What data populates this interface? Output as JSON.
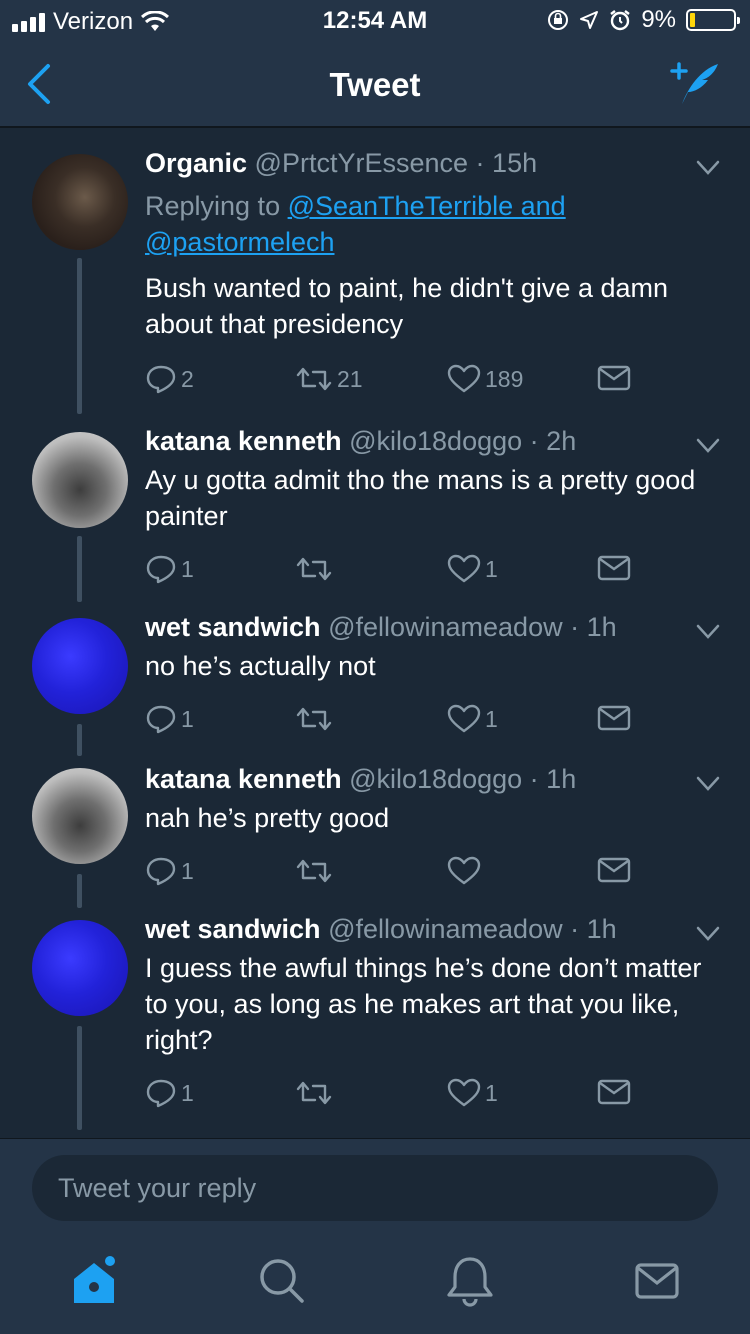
{
  "status_bar": {
    "carrier": "Verizon",
    "time": "12:54 AM",
    "battery": "9%",
    "battery_level": 0.09
  },
  "navbar": {
    "title": "Tweet",
    "back_icon": "chevron-left-icon",
    "compose_icon": "compose-tweet-icon"
  },
  "tweets": [
    {
      "name": "Organic",
      "handle": "@PrtctYrEssence",
      "time": "15h",
      "replying_prefix": "Replying to ",
      "replying_link_1": "@SeanTheTerrible and",
      "replying_link_2": "@pastormelech",
      "text": "Bush wanted to paint, he didn't give a damn about that presidency",
      "replies": "2",
      "retweets": "21",
      "likes": "189"
    },
    {
      "name": "katana kenneth",
      "handle": "@kilo18doggo",
      "time": "2h",
      "text": "Ay u gotta admit tho the mans is a pretty good painter",
      "replies": "1",
      "retweets": "",
      "likes": "1"
    },
    {
      "name": "wet sandwich",
      "handle": "@fellowinameadow",
      "time": "1h",
      "text": "no he’s actually not",
      "replies": "1",
      "retweets": "",
      "likes": "1"
    },
    {
      "name": "katana kenneth",
      "handle": "@kilo18doggo",
      "time": "1h",
      "text": "nah he’s pretty good",
      "replies": "1",
      "retweets": "",
      "likes": ""
    },
    {
      "name": "wet sandwich",
      "handle": "@fellowinameadow",
      "time": "1h",
      "text": "I guess the awful things he’s done don’t matter to you, as long as he makes art that you like, right?",
      "replies": "1",
      "retweets": "",
      "likes": "1"
    }
  ],
  "reply_input": {
    "placeholder": "Tweet your reply"
  },
  "tabbar": {
    "items": [
      "home-icon",
      "search-icon",
      "notifications-bell-icon",
      "messages-mail-icon"
    ],
    "accent": "#1da1f2"
  },
  "colors": {
    "background": "#1b2836",
    "header": "#243447",
    "secondary_text": "#8899a6",
    "link": "#1da1f2"
  }
}
